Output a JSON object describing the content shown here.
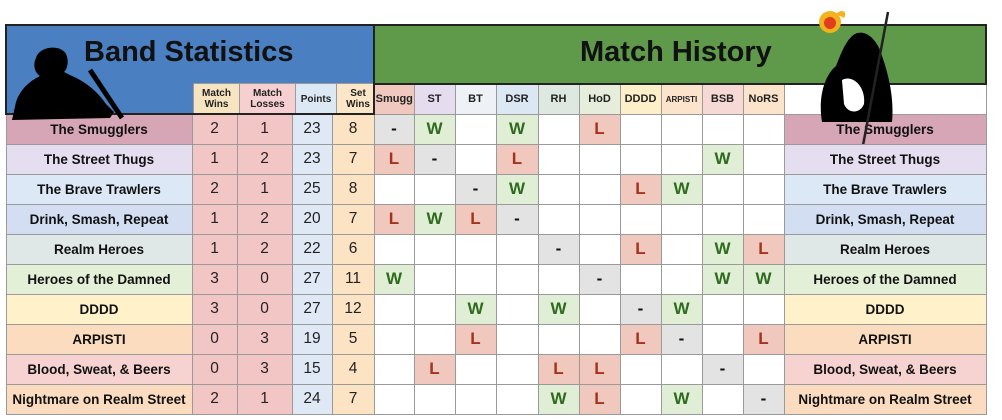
{
  "left_title": "Band Statistics",
  "right_title": "Match History",
  "stat_headers": [
    "Match Wins",
    "Match Losses",
    "Points",
    "Set Wins"
  ],
  "opponent_headers": [
    "Smugg",
    "ST",
    "BT",
    "DSR",
    "RH",
    "HoD",
    "DDDD",
    "ARPISTI",
    "BSB",
    "NoRS"
  ],
  "colors": {
    "stats_header": "#4a7fc1",
    "history_header": "#5e9a4a",
    "win_cell": "#dfeed5",
    "loss_cell": "#f1c8bd",
    "draw_cell": "#e3e3e3"
  },
  "icons": {
    "left": "musician-silhouette-icon",
    "right": "wizard-silhouette-icon"
  },
  "rows": [
    {
      "name": "The Smugglers",
      "wins": "2",
      "losses": "1",
      "points": "23",
      "set_wins": "8",
      "results": [
        "-",
        "W",
        "",
        "W",
        "",
        "L",
        "",
        "",
        "",
        ""
      ]
    },
    {
      "name": "The Street Thugs",
      "wins": "1",
      "losses": "2",
      "points": "23",
      "set_wins": "7",
      "results": [
        "L",
        "-",
        "",
        "L",
        "",
        "",
        "",
        "",
        "W",
        ""
      ]
    },
    {
      "name": "The Brave Trawlers",
      "wins": "2",
      "losses": "1",
      "points": "25",
      "set_wins": "8",
      "results": [
        "",
        "",
        "-",
        "W",
        "",
        "",
        "L",
        "W",
        "",
        ""
      ]
    },
    {
      "name": "Drink, Smash, Repeat",
      "wins": "1",
      "losses": "2",
      "points": "20",
      "set_wins": "7",
      "results": [
        "L",
        "W",
        "L",
        "-",
        "",
        "",
        "",
        "",
        "",
        ""
      ]
    },
    {
      "name": "Realm Heroes",
      "wins": "1",
      "losses": "2",
      "points": "22",
      "set_wins": "6",
      "results": [
        "",
        "",
        "",
        "",
        "-",
        "",
        "L",
        "",
        "W",
        "L"
      ]
    },
    {
      "name": "Heroes of the Damned",
      "wins": "3",
      "losses": "0",
      "points": "27",
      "set_wins": "11",
      "results": [
        "W",
        "",
        "",
        "",
        "",
        "-",
        "",
        "",
        "W",
        "W"
      ]
    },
    {
      "name": "DDDD",
      "wins": "3",
      "losses": "0",
      "points": "27",
      "set_wins": "12",
      "results": [
        "",
        "",
        "W",
        "",
        "W",
        "",
        "-",
        "W",
        "",
        ""
      ]
    },
    {
      "name": "ARPISTI",
      "wins": "0",
      "losses": "3",
      "points": "19",
      "set_wins": "5",
      "results": [
        "",
        "",
        "L",
        "",
        "",
        "",
        "L",
        "-",
        "",
        "L"
      ]
    },
    {
      "name": "Blood, Sweat, & Beers",
      "wins": "0",
      "losses": "3",
      "points": "15",
      "set_wins": "4",
      "results": [
        "",
        "L",
        "",
        "",
        "L",
        "L",
        "",
        "",
        "-",
        ""
      ]
    },
    {
      "name": "Nightmare on Realm Street",
      "wins": "2",
      "losses": "1",
      "points": "24",
      "set_wins": "7",
      "results": [
        "",
        "",
        "",
        "",
        "W",
        "L",
        "",
        "W",
        "",
        "-"
      ]
    }
  ]
}
